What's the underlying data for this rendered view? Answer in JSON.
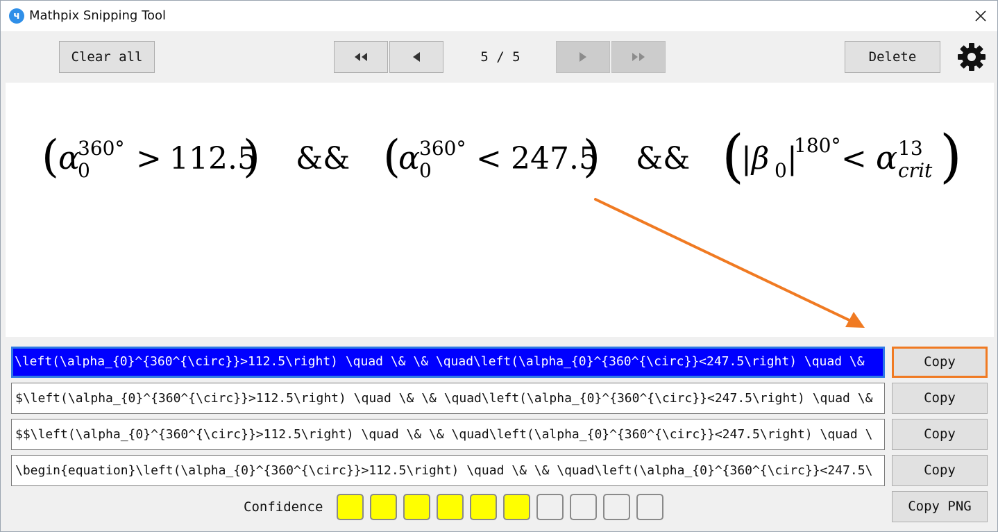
{
  "window": {
    "title": "Mathpix Snipping Tool",
    "logo_glyph": "ч"
  },
  "toolbar": {
    "clear_all_label": "Clear all",
    "counter": "5 / 5",
    "delete_label": "Delete"
  },
  "preview": {
    "formula": {
      "open1": "(",
      "alpha1": "α",
      "sup1": "360°",
      "sub1": "0",
      "op1": ">",
      "num1": "112.5",
      "close1": ")",
      "amp1": "&&",
      "open2": "(",
      "alpha2": "α",
      "sup2": "360°",
      "sub2": "0",
      "op2": "<",
      "num2": "247.5",
      "close2": ")",
      "amp2": "&&",
      "open3": "(",
      "bar": "|β",
      "sub3": "0",
      "bar2": "|",
      "sup3": "180°",
      "op3": "<",
      "alpha3": "α",
      "sup4": "13",
      "sub4": "crit",
      "close3": ")"
    },
    "annotation_arrow_color": "#f07a22"
  },
  "outputs": [
    {
      "text": "\\left(\\alpha_{0}^{360^{\\circ}}>112.5\\right) \\quad \\& \\& \\quad\\left(\\alpha_{0}^{360^{\\circ}}<247.5\\right) \\quad \\&",
      "copy_label": "Copy"
    },
    {
      "text": "$\\left(\\alpha_{0}^{360^{\\circ}}>112.5\\right) \\quad \\& \\& \\quad\\left(\\alpha_{0}^{360^{\\circ}}<247.5\\right) \\quad \\&",
      "copy_label": "Copy"
    },
    {
      "text": "$$\\left(\\alpha_{0}^{360^{\\circ}}>112.5\\right) \\quad \\& \\& \\quad\\left(\\alpha_{0}^{360^{\\circ}}<247.5\\right) \\quad \\",
      "copy_label": "Copy"
    },
    {
      "text": "\\begin{equation}\\left(\\alpha_{0}^{360^{\\circ}}>112.5\\right) \\quad \\& \\& \\quad\\left(\\alpha_{0}^{360^{\\circ}}<247.5\\",
      "copy_label": "Copy"
    }
  ],
  "copy_png_label": "Copy PNG",
  "confidence": {
    "label": "Confidence",
    "filled": 6,
    "total": 10,
    "fill_color": "#ffff00"
  },
  "colors": {
    "selection": "#0000ff",
    "focus_ring": "#f07a22",
    "logo": "#2f8fe8"
  }
}
